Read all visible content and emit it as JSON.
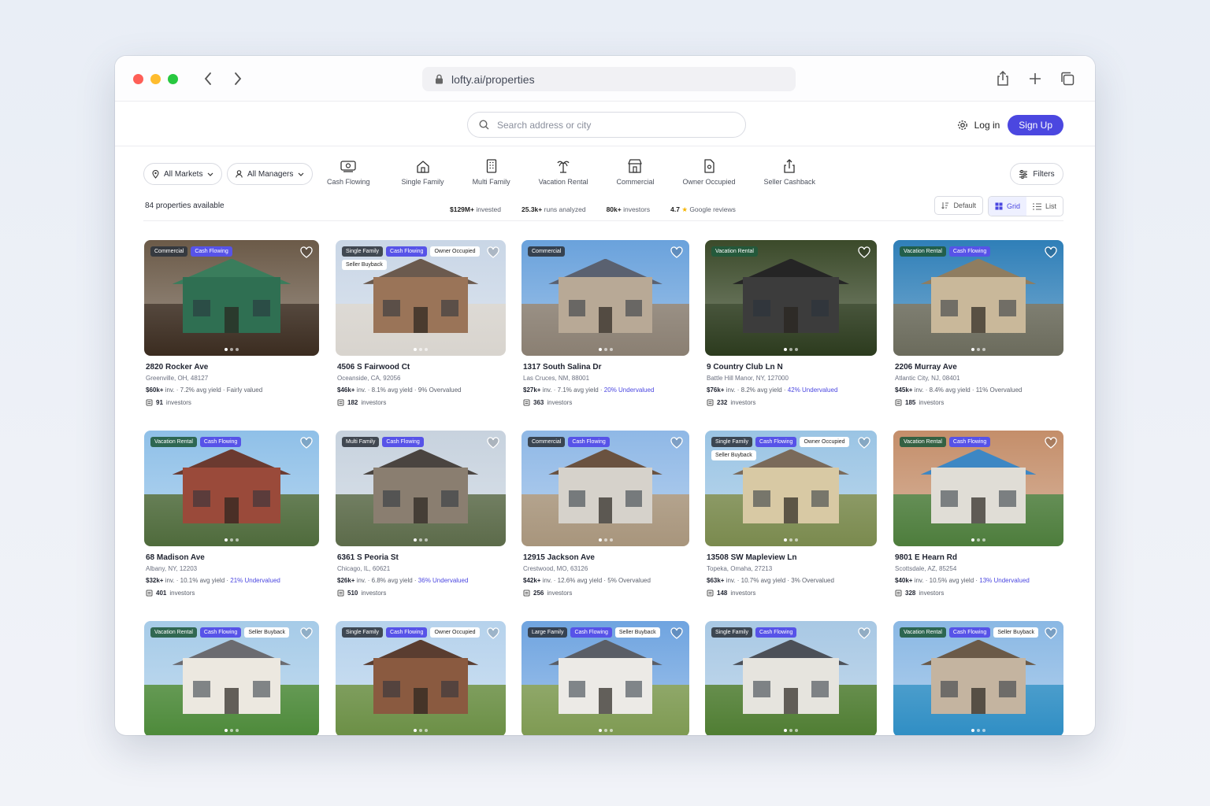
{
  "browser": {
    "url": "lofty.ai/properties"
  },
  "header": {
    "search_placeholder": "Search address or city",
    "login_label": "Log in",
    "signup_label": "Sign Up"
  },
  "filters": {
    "markets_label": "All Markets",
    "managers_label": "All Managers",
    "filters_label": "Filters",
    "categories": [
      {
        "label": "Cash Flowing",
        "icon": "cash-flowing-icon"
      },
      {
        "label": "Single Family",
        "icon": "home-icon"
      },
      {
        "label": "Multi Family",
        "icon": "building-icon"
      },
      {
        "label": "Vacation Rental",
        "icon": "palm-tree-icon"
      },
      {
        "label": "Commercial",
        "icon": "store-icon"
      },
      {
        "label": "Owner Occupied",
        "icon": "document-icon"
      },
      {
        "label": "Seller Cashback",
        "icon": "cashback-icon"
      }
    ]
  },
  "summary": {
    "count_text": "84 properties available",
    "stats": [
      {
        "value": "$129M+",
        "label": "invested"
      },
      {
        "value": "25.3k+",
        "label": "runs analyzed"
      },
      {
        "value": "80k+",
        "label": "investors"
      },
      {
        "value": "4.7",
        "label": "Google reviews"
      }
    ],
    "view": {
      "default_label": "Default",
      "grid_label": "Grid",
      "list_label": "List",
      "active": "Grid"
    }
  },
  "properties": [
    {
      "tags": [
        "Commercial",
        "Cash Flowing"
      ],
      "address": "2820 Rocker Ave",
      "city": "Greenville, OH, 48127",
      "inv": "$60k+",
      "yield": "7.2%",
      "valuation": "Fairly valued",
      "investors": "91",
      "scene": "storefront"
    },
    {
      "tags": [
        "Single Family",
        "Cash Flowing",
        "Owner Occupied",
        "Seller Buyback"
      ],
      "address": "4506 S Fairwood Ct",
      "city": "Oceanside, CA, 92056",
      "inv": "$46k+",
      "yield": "8.1%",
      "valuation": "9% Overvalued",
      "investors": "182",
      "scene": "winter"
    },
    {
      "tags": [
        "Commercial"
      ],
      "address": "1317 South Salina Dr",
      "city": "Las Cruces, NM, 88001",
      "inv": "$27k+",
      "yield": "7.1%",
      "valuation": "20% Undervalued",
      "investors": "363",
      "scene": "rooftop"
    },
    {
      "tags": [
        "Vacation Rental"
      ],
      "address": "9 Country Club Ln N",
      "city": "Battle Hill Manor, NY, 127000",
      "inv": "$76k+",
      "yield": "8.2%",
      "valuation": "42% Undervalued",
      "investors": "232",
      "scene": "forest"
    },
    {
      "tags": [
        "Vacation Rental",
        "Cash Flowing"
      ],
      "address": "2206 Murray Ave",
      "city": "Atlantic City, NJ, 08401",
      "inv": "$45k+",
      "yield": "8.4%",
      "valuation": "11% Overvalued",
      "investors": "185",
      "scene": "marina"
    },
    {
      "tags": [
        "Vacation Rental",
        "Cash Flowing"
      ],
      "address": "68 Madison Ave",
      "city": "Albany, NY, 12203",
      "inv": "$32k+",
      "yield": "10.1%",
      "valuation": "21% Undervalued",
      "investors": "401",
      "scene": "brick"
    },
    {
      "tags": [
        "Multi Family",
        "Cash Flowing"
      ],
      "address": "6361 S Peoria St",
      "city": "Chicago, IL, 60621",
      "inv": "$26k+",
      "yield": "6.8%",
      "valuation": "36% Undervalued",
      "investors": "510",
      "scene": "stone"
    },
    {
      "tags": [
        "Commercial",
        "Cash Flowing"
      ],
      "address": "12915 Jackson Ave",
      "city": "Crestwood, MO, 63126",
      "inv": "$42k+",
      "yield": "12.6%",
      "valuation": "5% Overvalued",
      "investors": "256",
      "scene": "duplex"
    },
    {
      "tags": [
        "Single Family",
        "Cash Flowing",
        "Owner Occupied",
        "Seller Buyback"
      ],
      "address": "13508 SW Mapleview Ln",
      "city": "Topeka, Omaha, 27213",
      "inv": "$63k+",
      "yield": "10.7%",
      "valuation": "3% Overvalued",
      "investors": "148",
      "scene": "garage"
    },
    {
      "tags": [
        "Vacation Rental",
        "Cash Flowing"
      ],
      "address": "9801 E Hearn Rd",
      "city": "Scottsdale,  AZ, 85254",
      "inv": "$40k+",
      "yield": "10.5%",
      "valuation": "13% Undervalued",
      "investors": "328",
      "scene": "pool-aerial"
    },
    {
      "tags": [
        "Vacation Rental",
        "Cash Flowing",
        "Seller Buyback"
      ],
      "scene": "porch"
    },
    {
      "tags": [
        "Single Family",
        "Cash Flowing",
        "Owner Occupied"
      ],
      "scene": "ranch"
    },
    {
      "tags": [
        "Large Family",
        "Cash Flowing",
        "Seller Buyback"
      ],
      "scene": "white"
    },
    {
      "tags": [
        "Single Family",
        "Cash Flowing"
      ],
      "scene": "cottage"
    },
    {
      "tags": [
        "Vacation Rental",
        "Cash Flowing",
        "Seller Buyback"
      ],
      "scene": "pool"
    }
  ],
  "colors": {
    "accent": "#4b47e0",
    "tag_blue": "#5753e8"
  }
}
